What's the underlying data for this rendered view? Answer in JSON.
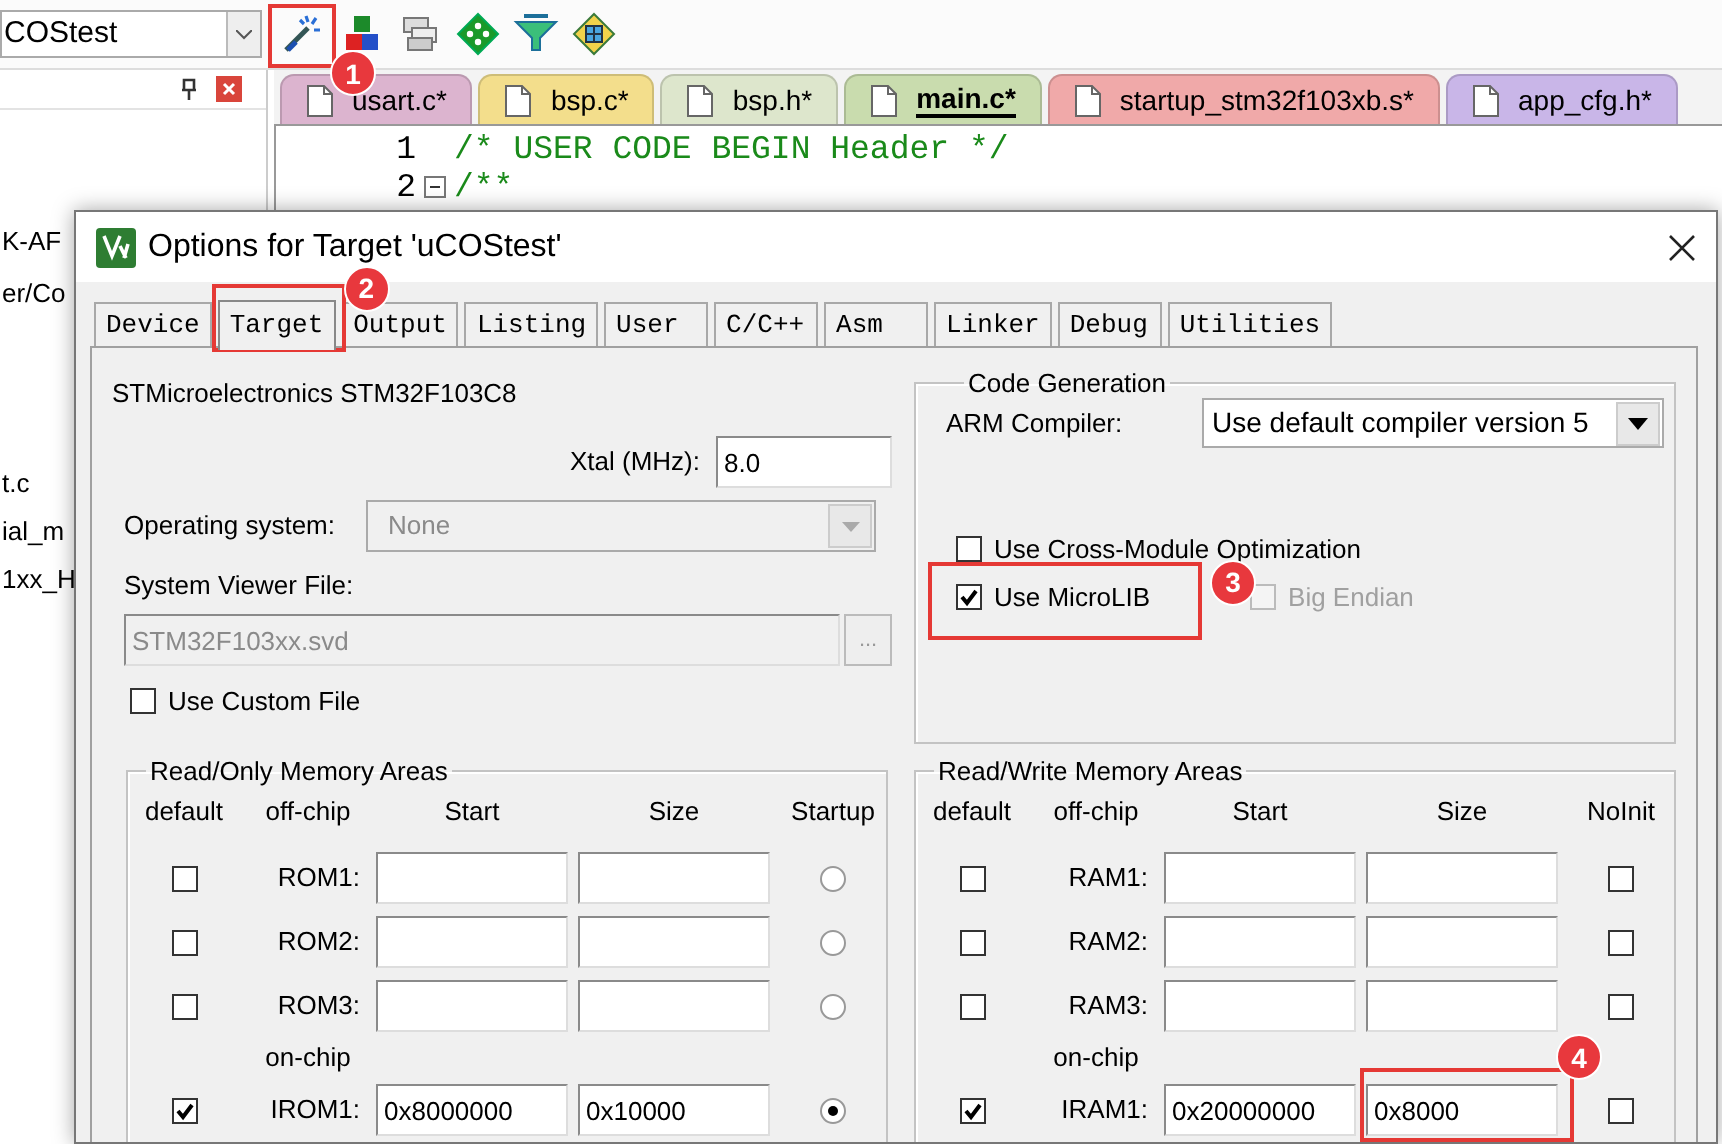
{
  "toolbar": {
    "project": "COStest",
    "callout": "1"
  },
  "project_panel": {
    "lines": [
      "K-AF",
      "er/Co",
      "t.c",
      "ial_m",
      "1xx_H"
    ]
  },
  "editor": {
    "tabs": [
      {
        "label": "usart.c*",
        "color": "#dcb4cf",
        "selected": false
      },
      {
        "label": "bsp.c*",
        "color": "#f3de8c",
        "selected": false
      },
      {
        "label": "bsp.h*",
        "color": "#dde6cc",
        "selected": false
      },
      {
        "label": "main.c*",
        "color": "#c9dcae",
        "selected": true
      },
      {
        "label": "startup_stm32f103xb.s*",
        "color": "#f0a9a9",
        "selected": false
      },
      {
        "label": "app_cfg.h*",
        "color": "#c9b6e8",
        "selected": false
      }
    ],
    "lines": [
      {
        "number": "1",
        "text": "/* USER CODE BEGIN Header */",
        "foldable": false
      },
      {
        "number": "2",
        "text": "/**",
        "foldable": true
      }
    ]
  },
  "dialog": {
    "title": "Options for Target 'uCOStest'",
    "tabs": [
      {
        "label": "Device",
        "selected": false
      },
      {
        "label": "Target",
        "selected": true,
        "callout": "2"
      },
      {
        "label": "Output",
        "selected": false
      },
      {
        "label": "Listing",
        "selected": false
      },
      {
        "label": "User",
        "selected": false
      },
      {
        "label": "C/C++",
        "selected": false
      },
      {
        "label": "Asm",
        "selected": false
      },
      {
        "label": "Linker",
        "selected": false
      },
      {
        "label": "Debug",
        "selected": false
      },
      {
        "label": "Utilities",
        "selected": false
      }
    ],
    "device": "STMicroelectronics STM32F103C8",
    "xtal": {
      "label": "Xtal (MHz):",
      "value": "8.0"
    },
    "operating_system": {
      "label": "Operating system:",
      "value": "None",
      "disabled": true
    },
    "system_viewer_file": {
      "label": "System Viewer File:",
      "value": "STM32F103xx.svd",
      "disabled": true,
      "browse": "..."
    },
    "use_custom_file": {
      "label": "Use Custom File",
      "checked": false
    },
    "code_generation": {
      "title": "Code Generation",
      "compiler_label": "ARM Compiler:",
      "compiler": "Use default compiler version 5",
      "options": [
        {
          "label": "Use Cross-Module Optimization",
          "checked": false,
          "disabled": false
        },
        {
          "label": "Use MicroLIB",
          "checked": true,
          "disabled": false,
          "callout": "3"
        },
        {
          "label": "Big Endian",
          "checked": false,
          "disabled": true
        }
      ]
    },
    "rom_areas": {
      "kind": "rom",
      "title": "Read/Only Memory Areas",
      "columns": [
        "default",
        "off-chip",
        "Start",
        "Size",
        "Startup"
      ],
      "onchip_label": "on-chip",
      "offchip_rows": [
        {
          "label": "ROM1:",
          "default": false,
          "startup": false
        },
        {
          "label": "ROM2:",
          "default": false,
          "startup": false
        },
        {
          "label": "ROM3:",
          "default": false,
          "startup": false
        }
      ],
      "onchip_rows": [
        {
          "label": "IROM1:",
          "default": true,
          "start": "0x8000000",
          "size": "0x10000",
          "startup": true
        }
      ]
    },
    "ram_areas": {
      "kind": "ram",
      "title": "Read/Write Memory Areas",
      "columns": [
        "default",
        "off-chip",
        "Start",
        "Size",
        "NoInit"
      ],
      "onchip_label": "on-chip",
      "offchip_rows": [
        {
          "label": "RAM1:",
          "default": false,
          "noinit": false
        },
        {
          "label": "RAM2:",
          "default": false,
          "noinit": false
        },
        {
          "label": "RAM3:",
          "default": false,
          "noinit": false
        }
      ],
      "onchip_rows": [
        {
          "label": "IRAM1:",
          "default": true,
          "start": "0x20000000",
          "size": "0x8000",
          "noinit": false,
          "size_callout": "4"
        }
      ]
    }
  }
}
